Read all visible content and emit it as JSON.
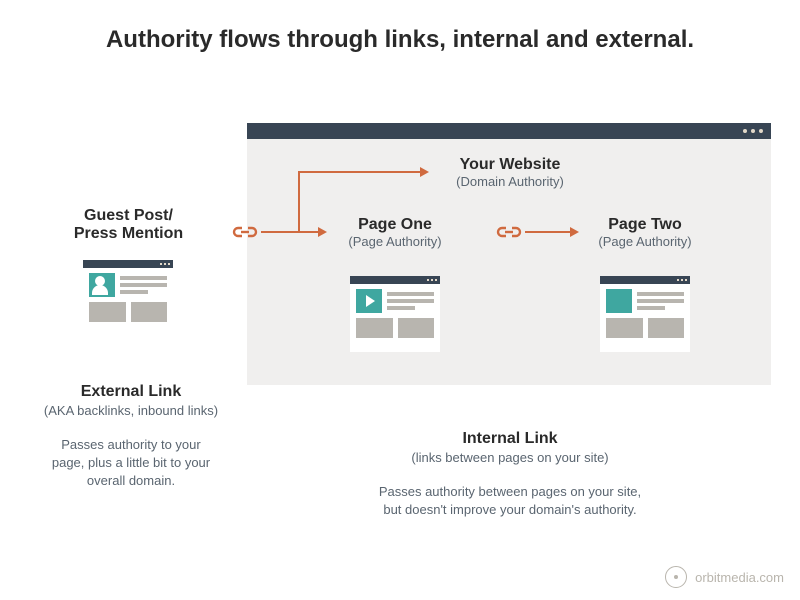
{
  "title": "Authority flows through links, internal and external.",
  "nodes": {
    "guest": {
      "heading": "Guest Post/\nPress Mention"
    },
    "website": {
      "heading": "Your Website",
      "sub": "(Domain Authority)"
    },
    "page1": {
      "heading": "Page One",
      "sub": "(Page Authority)"
    },
    "page2": {
      "heading": "Page Two",
      "sub": "(Page Authority)"
    }
  },
  "sections": {
    "external": {
      "heading": "External Link",
      "sub": "(AKA backlinks, inbound links)",
      "body": "Passes authority to your\npage, plus a little bit to your\noverall domain."
    },
    "internal": {
      "heading": "Internal Link",
      "sub": "(links between pages on your site)",
      "body": "Passes authority between pages on your site,\nbut doesn't improve your domain's authority."
    }
  },
  "footer": "orbitmedia.com",
  "colors": {
    "accent": "#d06a3f",
    "teal": "#3fa7a0",
    "bar": "#384554"
  }
}
